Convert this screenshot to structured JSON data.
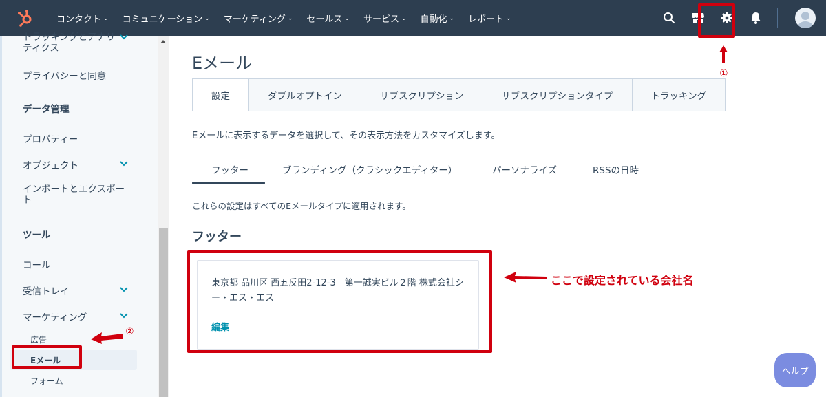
{
  "nav": {
    "items": [
      {
        "label": "コンタクト"
      },
      {
        "label": "コミュニケーション"
      },
      {
        "label": "マーケティング"
      },
      {
        "label": "セールス"
      },
      {
        "label": "サービス"
      },
      {
        "label": "自動化"
      },
      {
        "label": "レポート"
      }
    ],
    "chevron": "⌄"
  },
  "sidebar": {
    "tracking": "トラッキングとアナリティクス",
    "privacy": "プライバシーと同意",
    "data_head": "データ管理",
    "properties": "プロパティー",
    "objects": "オブジェクト",
    "import_export": "インポートとエクスポート",
    "tools_head": "ツール",
    "calls": "コール",
    "inbox": "受信トレイ",
    "marketing": "マーケティング",
    "ads": "広告",
    "email": "Eメール",
    "forms": "フォーム"
  },
  "page": {
    "title": "Eメール",
    "tabs": [
      "設定",
      "ダブルオプトイン",
      "サブスクリプション",
      "サブスクリプションタイプ",
      "トラッキング"
    ],
    "description": "Eメールに表示するデータを選択して、その表示方法をカスタマイズします。",
    "subtabs": [
      "フッター",
      "ブランディング（クラシックエディター）",
      "パーソナライズ",
      "RSSの日時"
    ],
    "applies_text": "これらの設定はすべてのEメールタイプに適用されます。",
    "section_title": "フッター",
    "footer_text": "東京都 品川区 西五反田2-12-3　第一誠実ビル２階 株式会社シー・エス・エス",
    "edit_label": "編集"
  },
  "annotations": {
    "num1": "①",
    "num2": "②",
    "company_note": "ここで設定されている会社名"
  },
  "help_label": "ヘルプ",
  "colors": {
    "nav_bg": "#2d3e50",
    "accent_red": "#d0000e",
    "link": "#0091ae",
    "help_bg": "#7b8ce0"
  }
}
